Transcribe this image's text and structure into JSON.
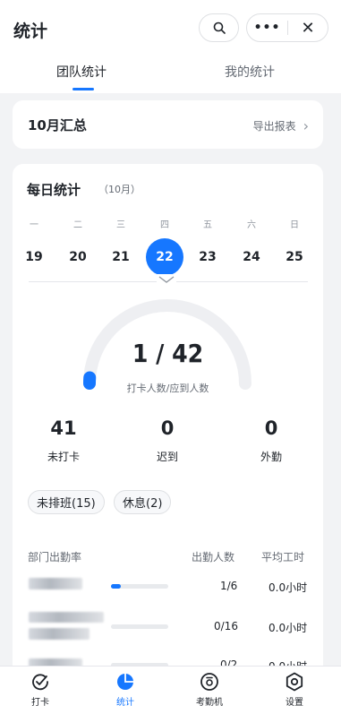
{
  "header": {
    "title": "统计",
    "tabs": [
      {
        "label": "团队统计",
        "active": true
      },
      {
        "label": "我的统计",
        "active": false
      }
    ]
  },
  "summary": {
    "title": "10月汇总",
    "export_label": "导出报表"
  },
  "daily": {
    "title": "每日统计",
    "month": "（10月）",
    "weekdays": [
      "一",
      "二",
      "三",
      "四",
      "五",
      "六",
      "日"
    ],
    "dates": [
      "19",
      "20",
      "21",
      "22",
      "23",
      "24",
      "25"
    ],
    "selected_date": "22",
    "ratio": "1 / 42",
    "ratio_fraction": 0.0238,
    "ratio_label": "打卡人数/应到人数",
    "stats": [
      {
        "value": "41",
        "label": "未打卡"
      },
      {
        "value": "0",
        "label": "迟到"
      },
      {
        "value": "0",
        "label": "外勤"
      }
    ],
    "chips": [
      "未排班(15)",
      "休息(2)"
    ]
  },
  "dept_table": {
    "headers": {
      "rate": "部门出勤率",
      "count": "出勤人数",
      "hours": "平均工时"
    },
    "rows": [
      {
        "count": "1/6",
        "hours": "0.0小时",
        "rate": 0.1667
      },
      {
        "count": "0/16",
        "hours": "0.0小时",
        "rate": 0
      },
      {
        "count": "0/2",
        "hours": "0.0小时",
        "rate": 0
      }
    ]
  },
  "bottom_nav": [
    {
      "label": "打卡",
      "icon": "check-circle-icon",
      "active": false
    },
    {
      "label": "统计",
      "icon": "pie-chart-icon",
      "active": true
    },
    {
      "label": "考勤机",
      "icon": "attendance-machine-icon",
      "active": false
    },
    {
      "label": "设置",
      "icon": "gear-icon",
      "active": false
    }
  ],
  "colors": {
    "accent": "#1677ff",
    "text": "#1f2329",
    "muted": "#646a73"
  }
}
